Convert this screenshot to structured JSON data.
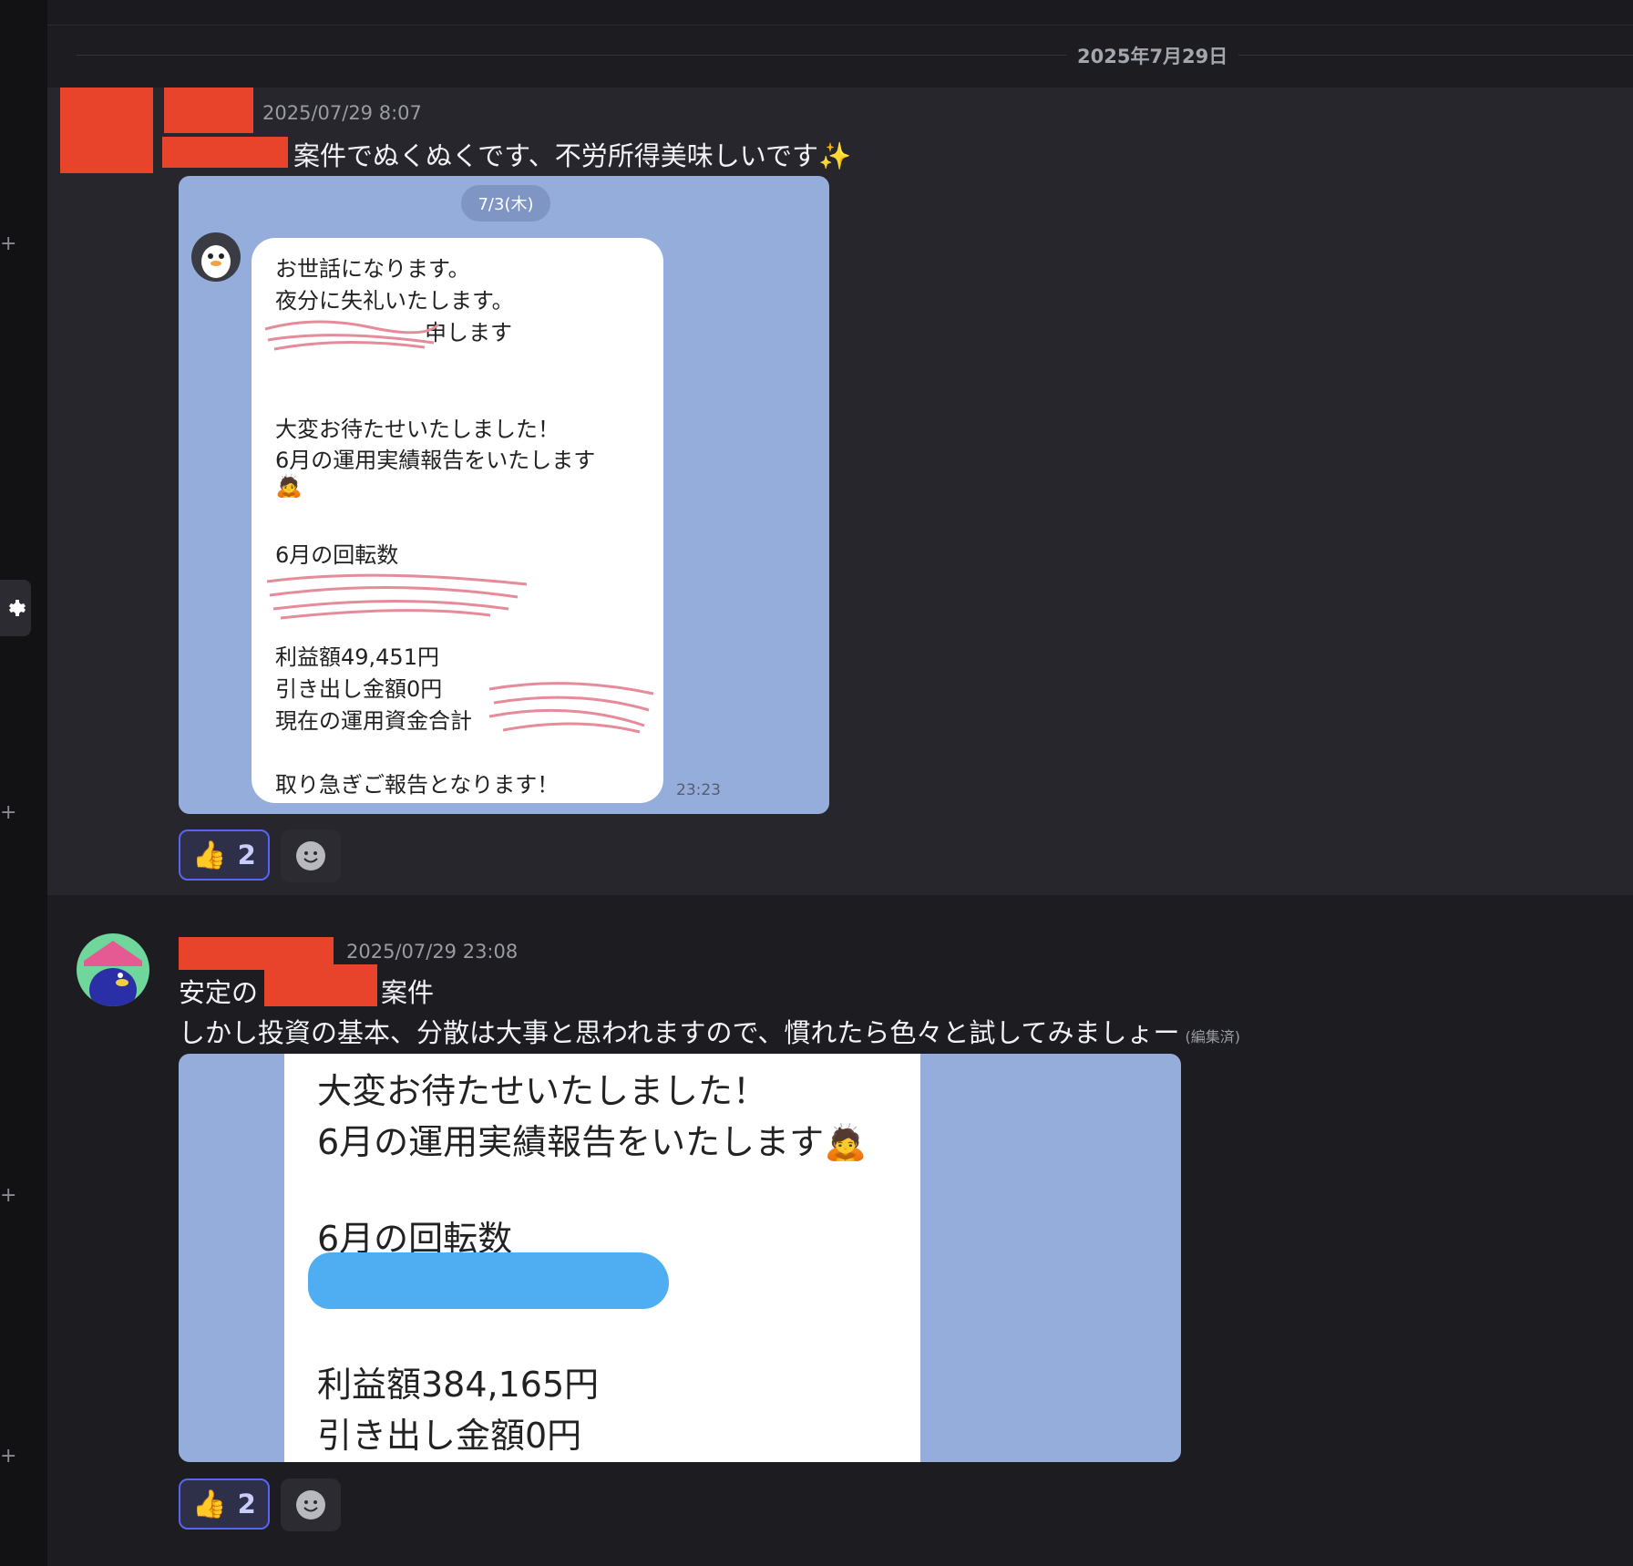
{
  "date_divider": "2025年7月29日",
  "message1": {
    "timestamp": "2025/07/29 8:07",
    "text": "案件でぬくぬくです、不労所得美味しいです✨",
    "screenshot": {
      "date_chip": "7/3(木)",
      "lines": [
        "お世話になります。",
        "夜分に失礼いたします。",
        "申します",
        "大変お待たせいたしました！",
        "6月の運用実績報告をいたします",
        "6月の回転数",
        "利益額49,451円",
        "引き出し金額0円",
        "現在の運用資金合計",
        "取り急ぎご報告となります！"
      ],
      "time": "23:23"
    },
    "reaction": {
      "emoji": "👍",
      "count": "2"
    }
  },
  "message2": {
    "timestamp": "2025/07/29 23:08",
    "line1_a": "安定の",
    "line1_b": "案件",
    "line2": "しかし投資の基本、分散は大事と思われますので、慣れたら色々と試してみましょー",
    "edited": "(編集済)",
    "screenshot": {
      "lines": [
        "大変お待たせいたしました！",
        "6月の運用実績報告をいたします🙇",
        "6月の回転数",
        "利益額384,165円",
        "引き出し金額0円"
      ]
    },
    "reaction": {
      "emoji": "👍",
      "count": "2"
    }
  },
  "colors": {
    "accent": "#5865f2",
    "redaction": "#e8432b",
    "chat_bg": "#95addb"
  }
}
